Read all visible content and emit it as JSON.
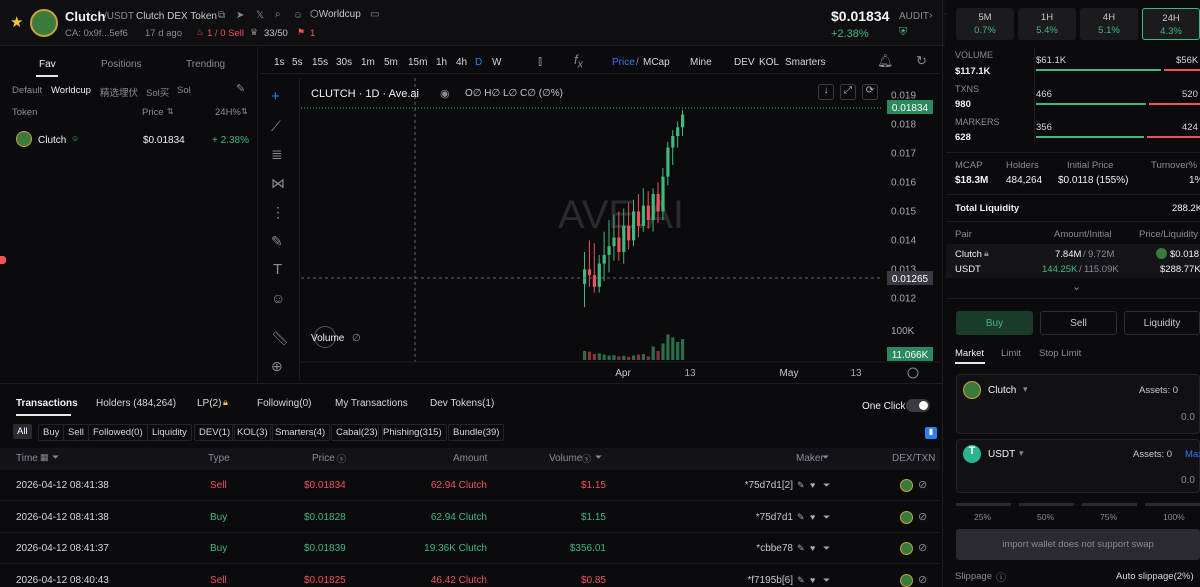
{
  "header": {
    "token_name": "Clutch",
    "pair_suffix": "/USDT",
    "token_full": "Clutch DEX Token",
    "tag": "Worldcup",
    "ca": "CA: 0x9f...5ef6",
    "age": "17 d ago",
    "sell_info": "1 / 0 Sell",
    "holders_ratio": "33/50",
    "alert_count": "1",
    "price": "$0.01834",
    "change": "+2.38%",
    "audit_label": "AUDIT"
  },
  "left_panel": {
    "tabs": [
      "Fav",
      "Positions",
      "Trending"
    ],
    "filters": [
      "Default",
      "Worldcup",
      "精选埋伏",
      "Sol买",
      "Sol"
    ],
    "col_token": "Token",
    "col_price": "Price",
    "col_change": "24H%",
    "item_name": "Clutch",
    "item_price": "$0.01834",
    "item_change": "+ 2.38%"
  },
  "chart_toolbar": {
    "intervals": [
      "1s",
      "5s",
      "15s",
      "30s",
      "1m",
      "5m",
      "15m",
      "1h",
      "4h",
      "D",
      "W"
    ],
    "price_label": "Price",
    "mcap_label": "MCap",
    "mine": "Mine",
    "dev": "DEV",
    "kol": "KOL",
    "smarters": "Smarters"
  },
  "chart_legend": {
    "title": "CLUTCH · 1D · Ave.ai",
    "ohlc": "O∅ H∅ L∅ C∅ (∅%)",
    "volume": "Volume",
    "volume_val": "∅",
    "watermark": "AVE.AI"
  },
  "chart_data": {
    "type": "candlestick",
    "y_ticks": [
      "0.019",
      "0.018",
      "0.017",
      "0.016",
      "0.015",
      "0.014",
      "0.013",
      "0.012"
    ],
    "y_range": [
      0.0116,
      0.0196
    ],
    "current_price_label": "0.01834",
    "crosshair_label": "0.01265",
    "volume_tick": "100K",
    "volume_label": "11.066K",
    "x_ticks": [
      "Apr",
      "13",
      "May",
      "13"
    ],
    "candles": [
      {
        "o": 0.0125,
        "h": 0.0136,
        "l": 0.0117,
        "c": 0.013,
        "v": 0.3
      },
      {
        "o": 0.013,
        "h": 0.014,
        "l": 0.0124,
        "c": 0.0128,
        "v": 0.28
      },
      {
        "o": 0.0128,
        "h": 0.0139,
        "l": 0.0122,
        "c": 0.0124,
        "v": 0.2
      },
      {
        "o": 0.0124,
        "h": 0.0135,
        "l": 0.0122,
        "c": 0.0132,
        "v": 0.22
      },
      {
        "o": 0.0132,
        "h": 0.0143,
        "l": 0.0126,
        "c": 0.0135,
        "v": 0.18
      },
      {
        "o": 0.0135,
        "h": 0.0147,
        "l": 0.0129,
        "c": 0.0138,
        "v": 0.15
      },
      {
        "o": 0.0138,
        "h": 0.0149,
        "l": 0.0133,
        "c": 0.0141,
        "v": 0.16
      },
      {
        "o": 0.0141,
        "h": 0.015,
        "l": 0.0133,
        "c": 0.0136,
        "v": 0.12
      },
      {
        "o": 0.0136,
        "h": 0.0151,
        "l": 0.0132,
        "c": 0.0145,
        "v": 0.14
      },
      {
        "o": 0.0145,
        "h": 0.0153,
        "l": 0.0137,
        "c": 0.014,
        "v": 0.1
      },
      {
        "o": 0.014,
        "h": 0.0154,
        "l": 0.0138,
        "c": 0.015,
        "v": 0.15
      },
      {
        "o": 0.015,
        "h": 0.0156,
        "l": 0.0141,
        "c": 0.0145,
        "v": 0.18
      },
      {
        "o": 0.0145,
        "h": 0.0158,
        "l": 0.0143,
        "c": 0.0152,
        "v": 0.2
      },
      {
        "o": 0.0152,
        "h": 0.0157,
        "l": 0.0144,
        "c": 0.0147,
        "v": 0.12
      },
      {
        "o": 0.0147,
        "h": 0.0158,
        "l": 0.0143,
        "c": 0.0156,
        "v": 0.45
      },
      {
        "o": 0.0156,
        "h": 0.016,
        "l": 0.0146,
        "c": 0.015,
        "v": 0.3
      },
      {
        "o": 0.015,
        "h": 0.0165,
        "l": 0.0147,
        "c": 0.0162,
        "v": 0.55
      },
      {
        "o": 0.0162,
        "h": 0.0174,
        "l": 0.0159,
        "c": 0.0172,
        "v": 0.85
      },
      {
        "o": 0.0172,
        "h": 0.0178,
        "l": 0.0166,
        "c": 0.0176,
        "v": 0.75
      },
      {
        "o": 0.0176,
        "h": 0.0181,
        "l": 0.0172,
        "c": 0.0179,
        "v": 0.6
      },
      {
        "o": 0.0179,
        "h": 0.0185,
        "l": 0.0176,
        "c": 0.01834,
        "v": 0.7
      }
    ]
  },
  "bottom": {
    "tabs": [
      "Transactions",
      "Holders (484,264)",
      "LP(2)",
      "Following(0)",
      "My Transactions",
      "Dev Tokens(1)"
    ],
    "one_click": "One Click",
    "filters": [
      "All",
      "Buy",
      "Sell",
      "Followed(0)",
      "Liquidity",
      "DEV(1)",
      "KOL(3)",
      "Smarters(4)",
      "Cabal(23)",
      "Phishing(315)",
      "Bundle(39)"
    ],
    "columns": {
      "time": "Time",
      "type": "Type",
      "price": "Price",
      "amount": "Amount",
      "volume": "Volume",
      "maker": "Maker",
      "dex": "DEX/TXN"
    },
    "rows": [
      {
        "time": "2026-04-12 08:41:38",
        "type": "Sell",
        "price": "$0.01834",
        "amount": "62.94 Clutch",
        "volume": "$1.15",
        "maker": "*75d7d1[2]"
      },
      {
        "time": "2026-04-12 08:41:38",
        "type": "Buy",
        "price": "$0.01828",
        "amount": "62.94 Clutch",
        "volume": "$1.15",
        "maker": "*75d7d1"
      },
      {
        "time": "2026-04-12 08:41:37",
        "type": "Buy",
        "price": "$0.01839",
        "amount": "19.36K Clutch",
        "volume": "$356.01",
        "maker": "*cbbe78"
      },
      {
        "time": "2026-04-12 08:40:43",
        "type": "Sell",
        "price": "$0.01825",
        "amount": "46.42 Clutch",
        "volume": "$0.85",
        "maker": "*f7195b[6]"
      }
    ]
  },
  "right_panel": {
    "timeframes": [
      {
        "label": "5M",
        "value": "0.7%"
      },
      {
        "label": "1H",
        "value": "5.4%"
      },
      {
        "label": "4H",
        "value": "5.1%"
      },
      {
        "label": "24H",
        "value": "4.3%"
      }
    ],
    "volume_label": "VOLUME",
    "volume_value": "$117.1K",
    "volume_buy": "$61.1K",
    "volume_sell": "$56K",
    "txns_label": "TXNS",
    "txns_value": "980",
    "txns_buy": "466",
    "txns_sell": "520",
    "markers_label": "MARKERS",
    "markers_value": "628",
    "markers_buy": "356",
    "markers_sell": "424",
    "mcap_label": "MCAP",
    "mcap_value": "$18.3M",
    "holders_label": "Holders",
    "holders_value": "484,264",
    "initial_label": "Initial Price",
    "initial_value": "$0.0118 (155%)",
    "turnover_label": "Turnover%",
    "turnover_value": "1%",
    "liquidity_label": "Total Liquidity",
    "liquidity_value": "288.2K",
    "pair_label": "Pair",
    "amount_label": "Amount/Initial",
    "price_liq_label": "Price/Liquidity",
    "pair1_name": "Clutch",
    "pair1_amount": "7.84M",
    "pair1_initial": "9.72M",
    "pair1_price": "$0.018",
    "pair2_name": "USDT",
    "pair2_amount": "144.25K",
    "pair2_initial": "115.09K",
    "pair2_liq": "$288.77K",
    "buy_label": "Buy",
    "sell_label": "Sell",
    "liquidity_btn": "Liquidity",
    "order_tabs": [
      "Market",
      "Limit",
      "Stop Limit"
    ],
    "asset1_name": "Clutch",
    "asset1_assets": "Assets: 0",
    "asset1_amount": "0.0",
    "asset2_name": "USDT",
    "asset2_assets": "Assets: 0",
    "asset2_max": "Max",
    "asset2_amount": "0.0",
    "pcts": [
      "25%",
      "50%",
      "75%",
      "100%"
    ],
    "import_msg": "import wallet does not support swap",
    "slippage_label": "Slippage",
    "auto_slippage": "Auto slippage(2%)"
  },
  "colors": {
    "green": "#3fb97e",
    "red": "#f0525a",
    "accent": "#2f7df6"
  }
}
